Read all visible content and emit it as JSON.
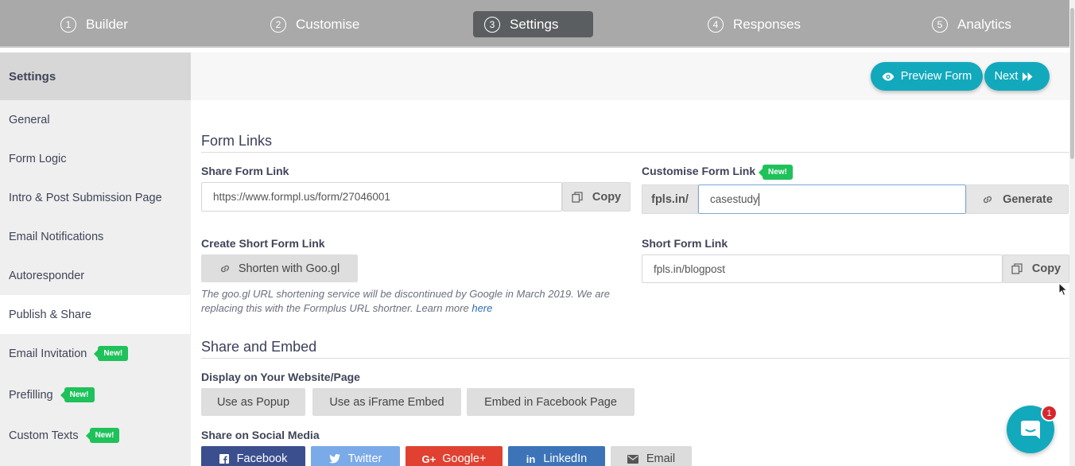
{
  "nav": {
    "steps": [
      {
        "num": "1",
        "label": "Builder"
      },
      {
        "num": "2",
        "label": "Customise"
      },
      {
        "num": "3",
        "label": "Settings"
      },
      {
        "num": "4",
        "label": "Responses"
      },
      {
        "num": "5",
        "label": "Analytics"
      }
    ]
  },
  "sidebar": {
    "header": "Settings",
    "items": [
      {
        "label": "General"
      },
      {
        "label": "Form Logic"
      },
      {
        "label": "Intro & Post Submission Page"
      },
      {
        "label": "Email Notifications"
      },
      {
        "label": "Autoresponder"
      },
      {
        "label": "Publish & Share"
      },
      {
        "label": "Email Invitation",
        "badge": "New!"
      },
      {
        "label": "Prefilling",
        "badge": "New!"
      },
      {
        "label": "Custom Texts",
        "badge": "New!"
      }
    ]
  },
  "actions": {
    "preview": "Preview Form",
    "next": "Next"
  },
  "form_links": {
    "title": "Form Links",
    "share_label": "Share Form Link",
    "share_url": "https://www.formpl.us/form/27046001",
    "copy": "Copy",
    "customise_label": "Customise Form Link",
    "customise_badge": "New!",
    "prefix": "fpls.in/",
    "custom_value": "casestudy",
    "generate": "Generate",
    "short_create_label": "Create Short Form Link",
    "shorten_button": "Shorten with Goo.gl",
    "note": "The goo.gl URL shortening service will be discontinued by Google in March 2019. We are replacing this with the Formplus URL shortner. Learn more",
    "note_link": "here",
    "short_label": "Short Form Link",
    "short_value": "fpls.in/blogpost",
    "copy2": "Copy"
  },
  "share_embed": {
    "title": "Share and Embed",
    "display_label": "Display on Your Website/Page",
    "buttons": [
      "Use as Popup",
      "Use as iFrame Embed",
      "Embed in Facebook Page"
    ],
    "social_label": "Share on Social Media",
    "social": [
      {
        "label": "Facebook",
        "color": "#3b4f8f"
      },
      {
        "label": "Twitter",
        "color": "#7aaae8"
      },
      {
        "label": "Google+",
        "color": "#e04131"
      },
      {
        "label": "LinkedIn",
        "color": "#3d74b8"
      },
      {
        "label": "Email",
        "color": "#dcdcdc"
      }
    ]
  },
  "chat": {
    "badge": "1"
  },
  "colors": {
    "accent": "#12a9bd",
    "new_badge": "#1fc15a",
    "nav_bg": "#a9a9a9"
  }
}
